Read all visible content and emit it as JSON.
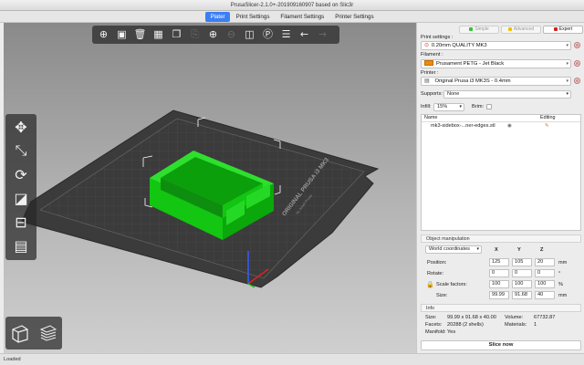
{
  "window": {
    "title": "PrusaSlicer-2.1.0+-201909160907 based on Slic3r"
  },
  "tabs": [
    {
      "label": "Plater",
      "active": true
    },
    {
      "label": "Print Settings"
    },
    {
      "label": "Filament Settings"
    },
    {
      "label": "Printer Settings"
    }
  ],
  "toolbar": {
    "icons": [
      "add-icon",
      "delete-icon",
      "delete-all-icon",
      "arrange-icon",
      "copy-icon",
      "paste-icon",
      "add-instance-icon",
      "remove-instance-icon",
      "split-objects-icon",
      "split-parts-icon",
      "layers-editing-icon",
      "undo-icon",
      "redo-icon"
    ]
  },
  "left_toolbar": {
    "icons": [
      "move-icon",
      "scale-icon",
      "rotate-icon",
      "place-on-face-icon",
      "cut-icon",
      "support-points-icon"
    ]
  },
  "bed": {
    "label_main": "ORIGINAL PRUSA i3 MK3",
    "label_sub": "by Josef Prusa"
  },
  "colors": {
    "accent": "#3b7ff5",
    "object_green": "#00e000",
    "expert_red": "#d32020",
    "filament": "#f0890c",
    "advanced_yellow": "#f0c000",
    "simple_green": "#35c235"
  },
  "sidebar": {
    "modes": [
      {
        "label": "Simple",
        "color": "#35c235"
      },
      {
        "label": "Advanced",
        "color": "#f0c000"
      },
      {
        "label": "Expert",
        "color": "#d32020",
        "active": true
      }
    ],
    "print_settings_label": "Print settings :",
    "print_settings_value": "0.20mm QUALITY MK3",
    "filament_label": "Filament :",
    "filament_value": "Prusament PETG - Jet Black",
    "printer_label": "Printer :",
    "printer_value": "Original Prusa i3 MK3S - 0.4mm",
    "supports_label": "Supports:",
    "supports_value": "None",
    "infill_label": "Infill:",
    "infill_value": "15%",
    "brim_label": "Brim:",
    "objects": {
      "name_header": "Name",
      "editing_header": "Editing",
      "rows": [
        {
          "name": "mk3-sidebox-...ner-edges.stl"
        }
      ]
    },
    "object_manipulation": {
      "title": "Object manipulation",
      "coord_system": "World coordinates",
      "axes": [
        "X",
        "Y",
        "Z"
      ],
      "position_label": "Position:",
      "position": [
        "125",
        "105",
        "20"
      ],
      "position_unit": "mm",
      "rotate_label": "Rotate:",
      "rotate": [
        "0",
        "0",
        "0"
      ],
      "rotate_unit": "°",
      "scale_label": "Scale factors:",
      "scale": [
        "100",
        "100",
        "100"
      ],
      "scale_unit": "%",
      "size_label": "Size:",
      "size": [
        "99.99",
        "91.68",
        "40"
      ],
      "size_unit": "mm"
    },
    "info": {
      "title": "Info",
      "size_label": "Size:",
      "size_value": "99.99 x 91.68 x 40.00",
      "volume_label": "Volume:",
      "volume_value": "67732.87",
      "facets_label": "Facets:",
      "facets_value": "20288 (2 shells)",
      "materials_label": "Materials:",
      "materials_value": "1",
      "manifold_label": "Manifold:",
      "manifold_value": "Yes"
    },
    "slice_button": "Slice now"
  },
  "status": {
    "text": "Loaded"
  }
}
